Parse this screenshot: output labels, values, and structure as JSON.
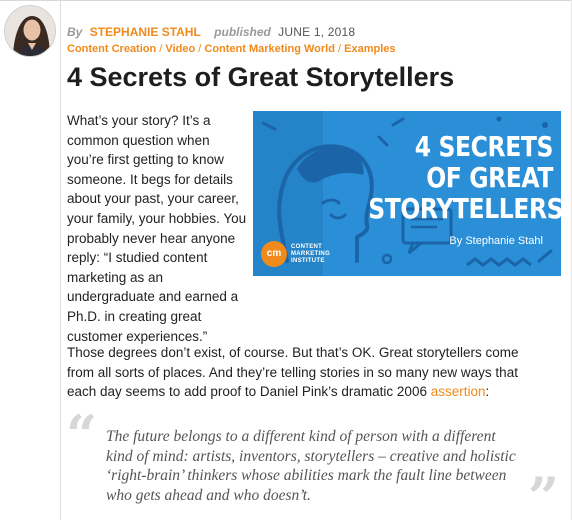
{
  "author": {
    "by_label": "By",
    "name": "STEPHANIE STAHL",
    "published_label": "published",
    "date": "JUNE 1, 2018"
  },
  "categories": [
    "Content Creation",
    "Video",
    "Content Marketing World",
    "Examples"
  ],
  "category_separator": "/",
  "title": "4 Secrets of Great Storytellers",
  "intro": "What’s your story? It’s a common question when you’re first getting to know someone. It begs for details about your past, your career, your family, your hobbies. You probably never hear anyone reply: “I studied content marketing as an undergraduate and earned a Ph.D. in creating great customer experiences.”",
  "hero": {
    "title_line1": "4 SECRETS",
    "title_line2": "OF GREAT",
    "title_line3": "STORYTELLERS",
    "byline": "By Stephanie Stahl",
    "logo_mark": "cm",
    "logo_text": "CONTENT MARKETING INSTITUTE",
    "bg_color": "#2a8fd6"
  },
  "paragraph2": {
    "before_link": "Those degrees don’t exist, of course. But that’s OK. Great storytellers come from all sorts of places. And they’re telling stories in so many new ways that each day seems to add proof to Daniel Pink’s dramatic 2006 ",
    "link_text": "assertion",
    "after_link": ":"
  },
  "quote": {
    "open_mark": "“",
    "close_mark": "”",
    "text": "The future belongs to a different kind of person with a different kind of mind: artists, inventors, storytellers – creative and holistic ‘right-brain’ thinkers whose abilities mark the fault line between who gets ahead and who doesn’t."
  },
  "colors": {
    "accent": "#f08a1c",
    "muted": "#9a9a9a",
    "quote_mark": "#d7d7d7"
  }
}
